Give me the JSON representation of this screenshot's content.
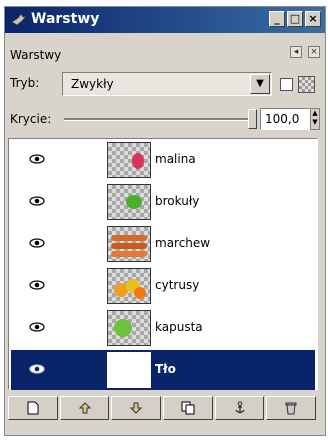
{
  "window": {
    "title": "Warstwy"
  },
  "titlebar_buttons": {
    "minimize": "_",
    "maximize": "□",
    "close": "×"
  },
  "panel": {
    "title": "Warstwy"
  },
  "mode": {
    "label": "Tryb:",
    "value": "Zwykły"
  },
  "opacity": {
    "label": "Krycie:",
    "value": "100,0"
  },
  "layers": [
    {
      "name": "malina",
      "visible": true,
      "selected": false,
      "thumb_color": "#d8345a"
    },
    {
      "name": "brokuły",
      "visible": true,
      "selected": false,
      "thumb_color": "#4caf2a"
    },
    {
      "name": "marchew",
      "visible": true,
      "selected": false,
      "thumb_color": "#d86a2a"
    },
    {
      "name": "cytrusy",
      "visible": true,
      "selected": false,
      "thumb_color": "#f0a020"
    },
    {
      "name": "kapusta",
      "visible": true,
      "selected": false,
      "thumb_color": "#6cc23a"
    },
    {
      "name": "Tło",
      "visible": true,
      "selected": true,
      "thumb_color": "#ffffff"
    }
  ],
  "toolbar": {
    "buttons": [
      "new-layer",
      "raise-layer",
      "lower-layer",
      "duplicate-layer",
      "anchor-layer",
      "delete-layer"
    ]
  },
  "colors": {
    "title_bar": "#0a246a",
    "selection": "#0a246a"
  }
}
